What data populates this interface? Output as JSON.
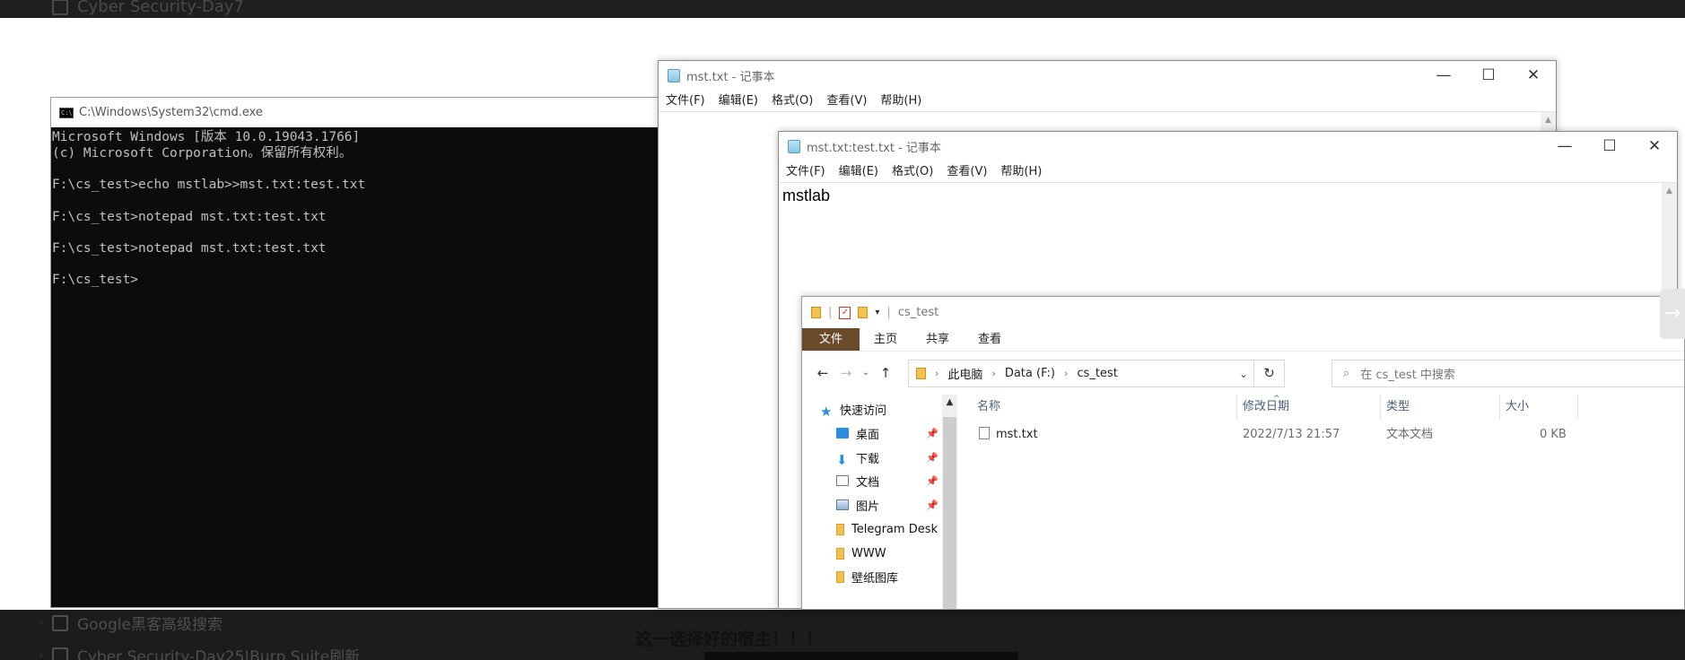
{
  "background": {
    "top_item": "Cyber Security-Day7",
    "bottom_items": [
      "Google黑客高级搜索",
      "Cyber Security-Day25|Burp Suite刷新"
    ],
    "caption": "这一选择好的宿主！！！"
  },
  "cmd": {
    "title": "C:\\Windows\\System32\\cmd.exe",
    "icon_label": "C:\\",
    "lines": [
      "Microsoft Windows [版本 10.0.19043.1766]",
      "(c) Microsoft Corporation。保留所有权利。",
      "",
      "F:\\cs_test>echo mstlab>>mst.txt:test.txt",
      "",
      "F:\\cs_test>notepad mst.txt:test.txt",
      "",
      "F:\\cs_test>notepad mst.txt:test.txt",
      "",
      "F:\\cs_test>"
    ]
  },
  "notepad1": {
    "title": "mst.txt - 记事本",
    "menu": [
      "文件(F)",
      "编辑(E)",
      "格式(O)",
      "查看(V)",
      "帮助(H)"
    ],
    "content": ""
  },
  "notepad2": {
    "title": "mst.txt:test.txt - 记事本",
    "menu": [
      "文件(F)",
      "编辑(E)",
      "格式(O)",
      "查看(V)",
      "帮助(H)"
    ],
    "content": "mstlab"
  },
  "window_controls": {
    "minimize": "—",
    "maximize": "☐",
    "close": "✕"
  },
  "explorer": {
    "title": "cs_test",
    "ribbon_tabs": [
      "文件",
      "主页",
      "共享",
      "查看"
    ],
    "breadcrumb": [
      "此电脑",
      "Data (F:)",
      "cs_test"
    ],
    "search_placeholder": "在 cs_test 中搜索",
    "nav": [
      {
        "label": "快速访问",
        "icon": "star-icon",
        "pinned": false
      },
      {
        "label": "桌面",
        "icon": "desktop-icon",
        "pinned": true
      },
      {
        "label": "下载",
        "icon": "download-icon",
        "pinned": true
      },
      {
        "label": "文档",
        "icon": "documents-icon",
        "pinned": true
      },
      {
        "label": "图片",
        "icon": "pictures-icon",
        "pinned": true
      },
      {
        "label": "Telegram Desk",
        "icon": "folder-icon",
        "pinned": false
      },
      {
        "label": "WWW",
        "icon": "folder-icon",
        "pinned": false
      },
      {
        "label": "壁纸图库",
        "icon": "folder-icon",
        "pinned": false
      }
    ],
    "columns": [
      "名称",
      "修改日期",
      "类型",
      "大小"
    ],
    "files": [
      {
        "name": "mst.txt",
        "modified": "2022/7/13 21:57",
        "type": "文本文档",
        "size": "0 KB"
      }
    ]
  },
  "colors": {
    "accent_file_tab": "#6b4a2c",
    "cmd_background": "#0c0c0c",
    "cmd_text": "#c0c0c0"
  }
}
